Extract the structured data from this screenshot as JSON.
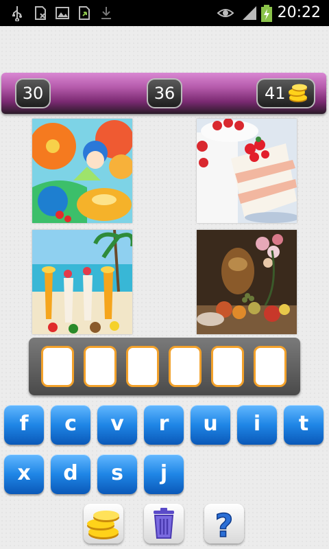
{
  "status_bar": {
    "time": "20:22",
    "icons": [
      "usb-icon",
      "sim-icon",
      "image-icon",
      "upload-icon",
      "download-icon",
      "eye-icon",
      "signal-icon",
      "battery-charging-icon"
    ]
  },
  "scores": {
    "left": "30",
    "level": "36",
    "coins": "41",
    "coin_icon": "coin-stack-icon"
  },
  "images": [
    {
      "name": "anime-girl-fruit-jelly",
      "dominant_colors": [
        "#f58a20",
        "#5bc8e8",
        "#f7d14a"
      ]
    },
    {
      "name": "strawberry-cream-cake",
      "dominant_colors": [
        "#ffffff",
        "#e5343b",
        "#f5d2a8"
      ]
    },
    {
      "name": "beach-fruit-cocktails",
      "dominant_colors": [
        "#f6b223",
        "#7cc4e8",
        "#f2f2f2"
      ]
    },
    {
      "name": "still-life-fruit-flowers",
      "dominant_colors": [
        "#3a2a1a",
        "#c96b3a",
        "#e0c0b0"
      ]
    }
  ],
  "answer": {
    "slots": [
      "",
      "",
      "",
      "",
      "",
      ""
    ],
    "slot_border_color": "#f2a12b"
  },
  "keyboard": {
    "row1": [
      "f",
      "c",
      "v",
      "r",
      "u",
      "i",
      "t"
    ],
    "row2": [
      "x",
      "d",
      "s",
      "j"
    ],
    "key_color": "#1f86e6"
  },
  "tools": [
    {
      "name": "coins-button",
      "icon": "coin-stack-icon"
    },
    {
      "name": "delete-button",
      "icon": "trash-icon"
    },
    {
      "name": "hint-button",
      "icon": "question-mark-icon",
      "label": "?"
    }
  ],
  "colors": {
    "score_bar": "#b55bab",
    "background": "#ececec"
  }
}
